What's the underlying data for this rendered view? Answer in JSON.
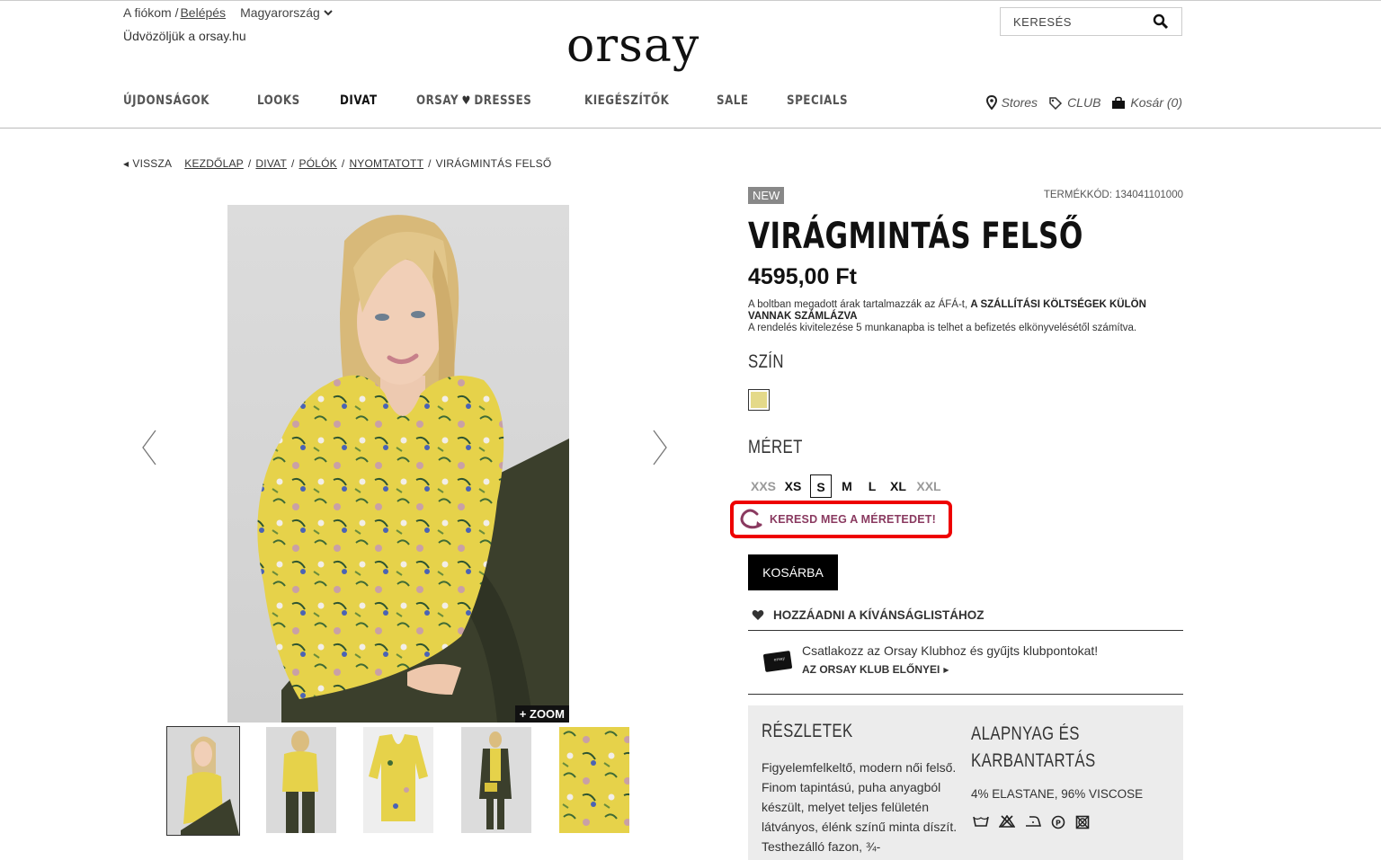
{
  "header": {
    "account_prefix": "A fiókom /",
    "login": "Belépés",
    "country": "Magyarország",
    "welcome": "Üdvözöljük a orsay.hu",
    "logo_text": "orsay",
    "search_placeholder": "KERESÉS"
  },
  "nav": {
    "items": [
      "ÚJDONSÁGOK",
      "LOOKS",
      "DIVAT",
      "ORSAY",
      "SALE",
      "SPECIALS"
    ],
    "kiegeszitok": "KIEGÉSZÍTŐK",
    "dresses_left": "ORSAY",
    "dresses_right": "DRESSES",
    "stores": "Stores",
    "club": "CLUB",
    "cart": "Kosár (0)"
  },
  "breadcrumb": {
    "back": "VISSZA",
    "items": [
      "KEZDŐLAP",
      "DIVAT",
      "PÓLÓK",
      "NYOMTATOTT"
    ],
    "current": "VIRÁGMINTÁS FELSŐ"
  },
  "gallery": {
    "zoom": "+ ZOOM",
    "thumbnail_count": 5
  },
  "product": {
    "badge": "NEW",
    "code": "TERMÉKKÓD: 134041101000",
    "title": "VIRÁGMINTÁS FELSŐ",
    "price": "4595,00 Ft",
    "price_note_1": "A boltban megadott árak tartalmazzák az ÁFÁ-t, ",
    "price_note_bold": "A SZÁLLÍTÁSI KÖLTSÉGEK KÜLÖN VANNAK SZÁMLÁZVA",
    "price_note_2": "A rendelés kivitelezése 5 munkanapba is telhet a befizetés elkönyvelésétől számítva.",
    "color_label": "SZÍN",
    "size_label": "MÉRET",
    "sizes": [
      {
        "label": "XXS",
        "state": "disabled"
      },
      {
        "label": "XS",
        "state": "available"
      },
      {
        "label": "S",
        "state": "selected"
      },
      {
        "label": "M",
        "state": "available"
      },
      {
        "label": "L",
        "state": "available"
      },
      {
        "label": "XL",
        "state": "available"
      },
      {
        "label": "XXL",
        "state": "disabled"
      }
    ],
    "size_finder": "KERESD MEG A MÉRETEDET!",
    "add_to_cart": "KOSÁRBA",
    "wishlist": "HOZZÁADNI A KÍVÁNSÁGLISTÁHOZ",
    "club_text": "Csatlakozz az Orsay Klubhoz és gyűjts klubpontokat!",
    "club_link": "AZ ORSAY KLUB ELŐNYEI",
    "details_title": "RÉSZLETEK",
    "details_text": "Figyelemfelkeltő, modern női felső. Finom tapintású, puha anyagból készült, melyet teljes felületén látványos, élénk színű minta díszít. Testhezálló fazon, ¾-",
    "material_title": "ALAPNYAG ÉS KARBANTARTÁS",
    "material_text": "4% ELASTANE, 96% VISCOSE"
  },
  "colors": {
    "accent_highlight": "#e00000",
    "size_finder_text": "#8a3a60",
    "shirt_yellow": "#e6d24a"
  }
}
